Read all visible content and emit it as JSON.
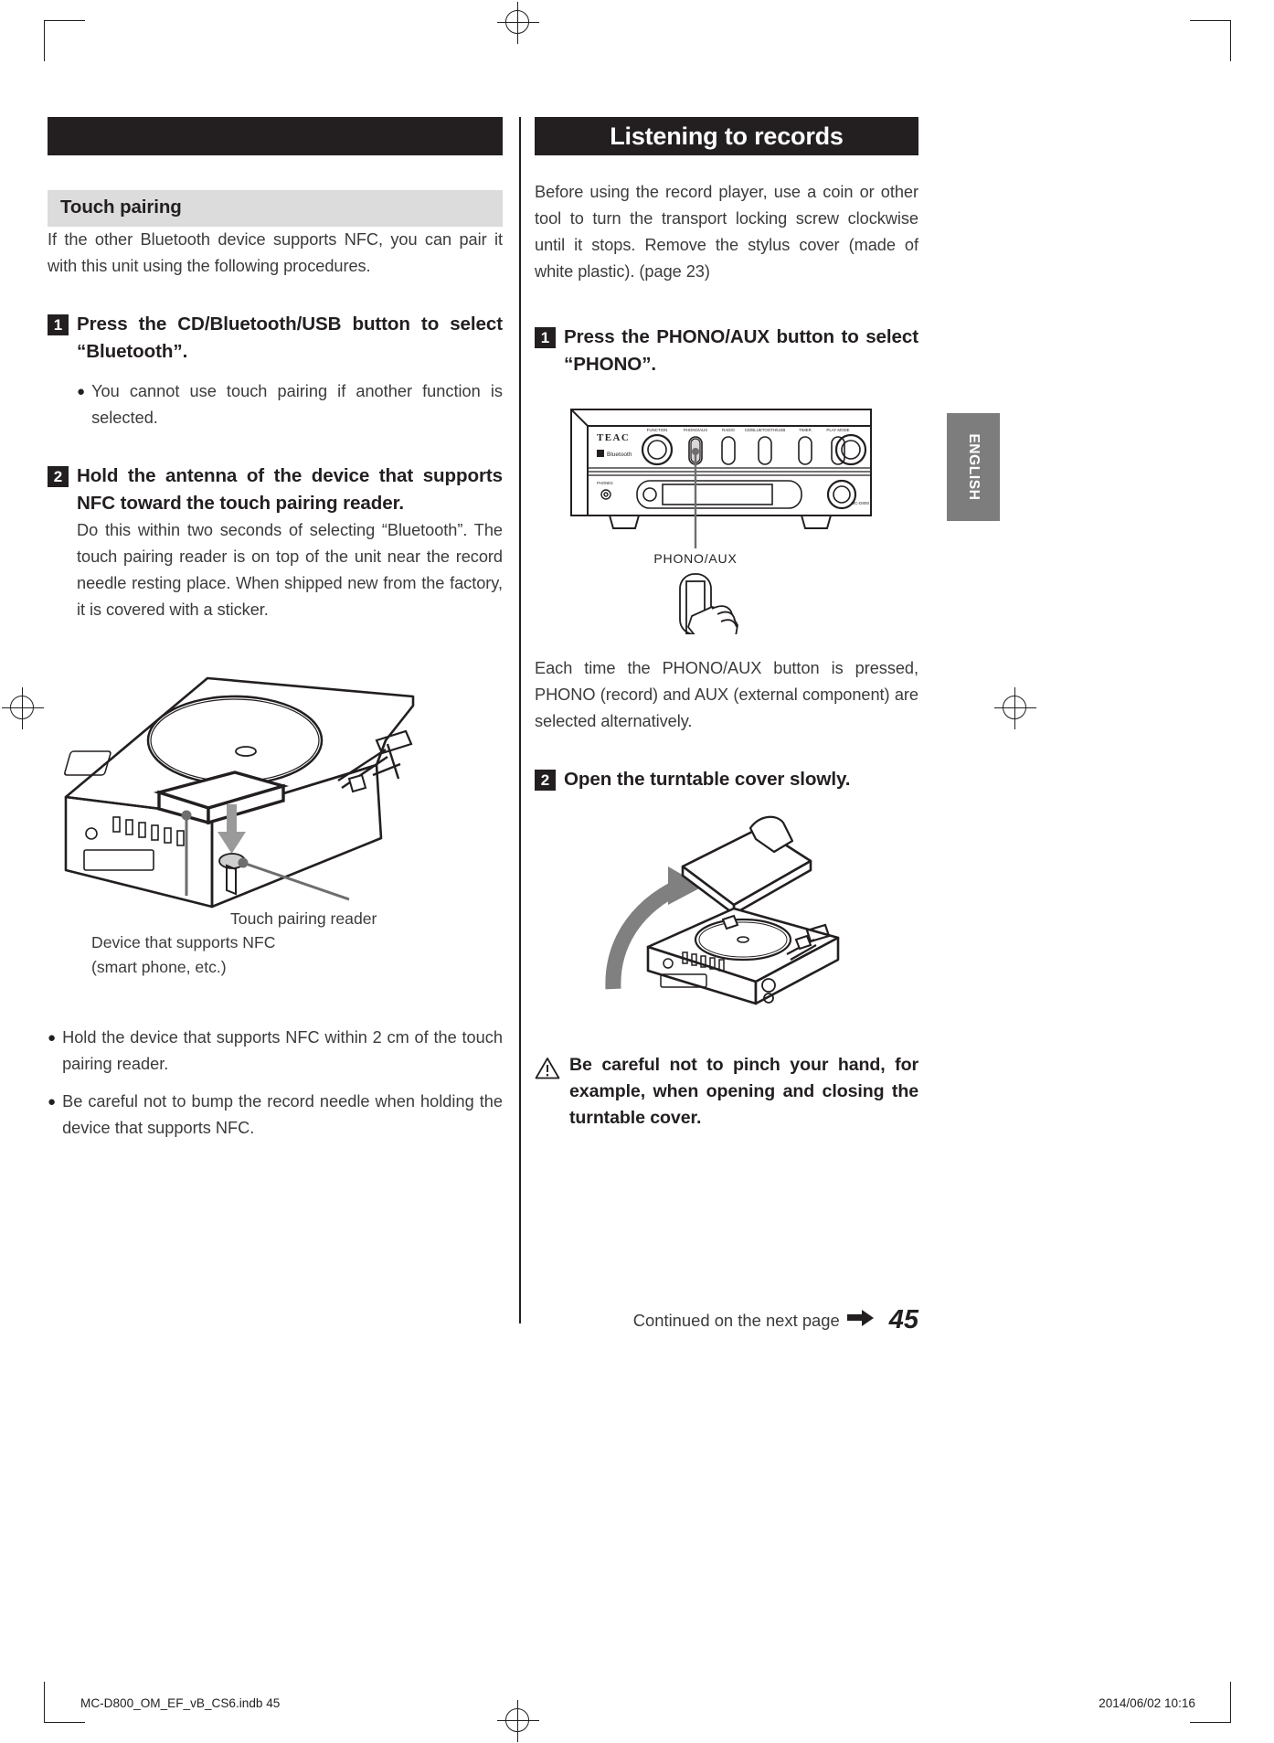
{
  "page": {
    "number": "45",
    "language_tab": "ENGLISH",
    "continued_note": "Continued on the next page",
    "print_file": "MC-D800_OM_EF_vB_CS6.indb   45",
    "print_timestamp": "2014/06/02   10:16"
  },
  "left_column": {
    "top_bar_title": "",
    "section_heading": "Touch pairing",
    "intro": "If the other Bluetooth device supports NFC, you can pair it with this unit using the following procedures.",
    "step1": {
      "number": "1",
      "text": "Press the CD/Bluetooth/USB button to select “Bluetooth”.",
      "bullets": [
        "You cannot use touch pairing if another function is selected."
      ]
    },
    "step2": {
      "number": "2",
      "text": "Hold the antenna of the device that supports NFC toward the touch pairing reader.",
      "body": "Do this within two seconds of selecting “Bluetooth”. The touch pairing reader is on top of the unit near the record needle resting place. When shipped new from the factory, it is covered with a sticker."
    },
    "figure_captions": {
      "reader": "Touch pairing reader",
      "device_line1": "Device that supports NFC",
      "device_line2": "(smart phone, etc.)"
    },
    "closing_bullets": [
      "Hold the device that supports NFC within 2 cm of the touch pairing reader.",
      "Be careful not to bump the record needle when holding the device that supports NFC."
    ]
  },
  "right_column": {
    "title": "Listening to records",
    "intro": "Before using the record player, use a coin or other tool to turn the transport locking screw clockwise until it stops. Remove the stylus cover (made of white plastic). (page 23)",
    "step1": {
      "number": "1",
      "text": "Press the PHONO/AUX button to select “PHONO”.",
      "figure": {
        "brand": "TEAC",
        "bluetooth_badge": "Bluetooth",
        "model": "MC-D800",
        "button_label": "PHONO/AUX"
      },
      "body": "Each time the PHONO/AUX button is pressed, PHONO (record) and AUX (external component) are selected alternatively."
    },
    "step2": {
      "number": "2",
      "text": "Open the turntable cover slowly."
    },
    "warning": "Be careful not to pinch your hand, for example, when opening and closing the turntable cover."
  },
  "colors": {
    "ink": "#231f20",
    "body_text": "#3b3b3b",
    "gray_heading_bg": "#dcdcdc",
    "side_tab_bg": "#7d7d7d",
    "arrow_gray": "#808080"
  }
}
